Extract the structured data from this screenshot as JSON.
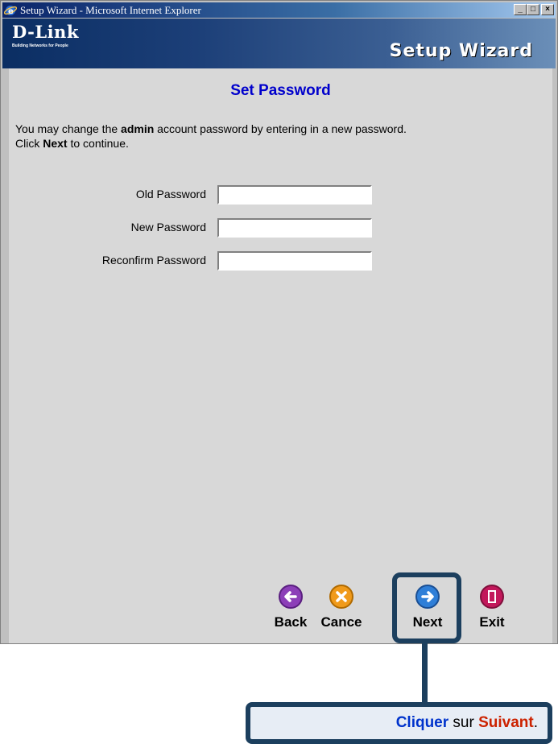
{
  "window": {
    "title": "Setup Wizard - Microsoft Internet Explorer",
    "controls": [
      "_",
      "□",
      "×"
    ]
  },
  "banner": {
    "logo": "D-Link",
    "tagline": "Building Networks for People",
    "title": "Setup Wizard"
  },
  "page": {
    "title": "Set Password",
    "intro_part1": "You may change the ",
    "intro_bold1": "admin",
    "intro_part2": " account password by entering in a new password.",
    "intro_part3": "Click ",
    "intro_bold2": "Next",
    "intro_part4": " to continue."
  },
  "form": {
    "old_password_label": "Old Password",
    "old_password_value": "",
    "new_password_label": "New Password",
    "new_password_value": "",
    "reconfirm_password_label": "Reconfirm Password",
    "reconfirm_password_value": ""
  },
  "nav": {
    "back_label": "Back",
    "cancel_label": "Cance",
    "next_label": "Next",
    "exit_label": "Exit"
  },
  "callout": {
    "word1": "Cliquer",
    "word2": " sur ",
    "word3": "Suivant",
    "word4": "."
  },
  "icons": {
    "back": "left-arrow-icon",
    "cancel": "x-icon",
    "next": "right-arrow-icon",
    "exit": "door-icon"
  },
  "colors": {
    "title_blue": "#0000cc",
    "callout_border": "#1c3f5e",
    "callout_blue": "#0033cc",
    "callout_red": "#cc2200"
  }
}
